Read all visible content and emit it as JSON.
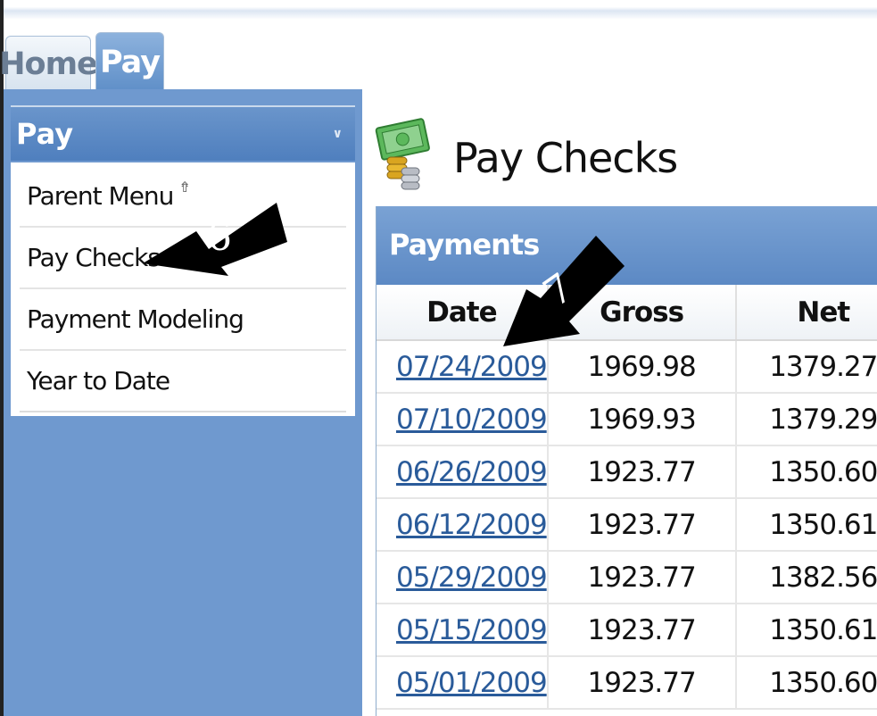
{
  "tabs": [
    {
      "label": "Home",
      "active": false
    },
    {
      "label": "Pay",
      "active": true
    }
  ],
  "sidebar": {
    "header": "Pay",
    "header_chevron": "chevron-down-icon",
    "items": [
      {
        "label": "Parent Menu",
        "icon": "up-arrow-icon"
      },
      {
        "label": "Pay Checks"
      },
      {
        "label": "Payment Modeling"
      },
      {
        "label": "Year to Date"
      }
    ]
  },
  "main": {
    "icon": "money-icon",
    "title": "Pay Checks",
    "panel_title": "Payments",
    "columns": [
      "Date",
      "Gross",
      "Net"
    ],
    "rows": [
      {
        "date": "07/24/2009",
        "gross": "1969.98",
        "net": "1379.27"
      },
      {
        "date": "07/10/2009",
        "gross": "1969.93",
        "net": "1379.29"
      },
      {
        "date": "06/26/2009",
        "gross": "1923.77",
        "net": "1350.60"
      },
      {
        "date": "06/12/2009",
        "gross": "1923.77",
        "net": "1350.61"
      },
      {
        "date": "05/29/2009",
        "gross": "1923.77",
        "net": "1382.56"
      },
      {
        "date": "05/15/2009",
        "gross": "1923.77",
        "net": "1350.61"
      },
      {
        "date": "05/01/2009",
        "gross": "1923.77",
        "net": "1350.60"
      }
    ]
  },
  "annotations": [
    {
      "label": "6"
    },
    {
      "label": "7"
    }
  ],
  "colors": {
    "accent": "#5f8fc8",
    "link": "#2a5b9a"
  }
}
